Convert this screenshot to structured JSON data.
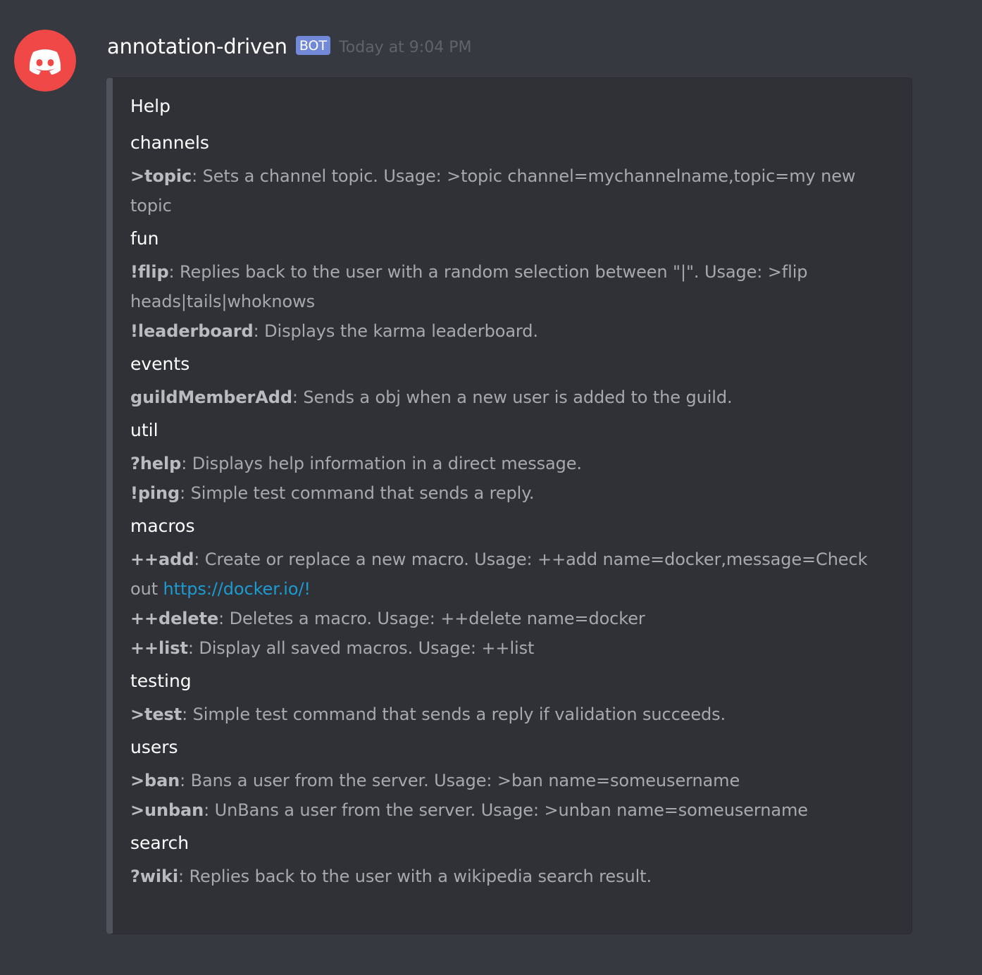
{
  "message": {
    "author": "annotation-driven",
    "bot_tag": "BOT",
    "timestamp": "Today at 9:04 PM",
    "avatar_icon": "discord-logo-icon",
    "avatar_color": "#f04747"
  },
  "embed": {
    "title": "Help",
    "border_color": "#4f545c",
    "fields": [
      {
        "name": "channels",
        "commands": [
          {
            "cmd": ">topic",
            "desc": ": Sets a channel topic. Usage: >topic channel=mychannelname,topic=my new topic"
          }
        ]
      },
      {
        "name": "fun",
        "commands": [
          {
            "cmd": "!flip",
            "desc": ": Replies back to the user with a random selection between \"|\". Usage: >flip heads|tails|whoknows"
          },
          {
            "cmd": "!leaderboard",
            "desc": ": Displays the karma leaderboard."
          }
        ]
      },
      {
        "name": "events",
        "commands": [
          {
            "cmd": "guildMemberAdd",
            "desc": ": Sends a obj when a new user is added to the guild."
          }
        ]
      },
      {
        "name": "util",
        "commands": [
          {
            "cmd": "?help",
            "desc": ": Displays help information in a direct message."
          },
          {
            "cmd": "!ping",
            "desc": ": Simple test command that sends a reply."
          }
        ]
      },
      {
        "name": "macros",
        "commands": [
          {
            "cmd": "++add",
            "desc": ": Create or replace a new macro. Usage: ++add name=docker,message=Check out ",
            "link": "https://docker.io/!"
          },
          {
            "cmd": "++delete",
            "desc": ": Deletes a macro. Usage: ++delete name=docker"
          },
          {
            "cmd": "++list",
            "desc": ": Display all saved macros. Usage: ++list"
          }
        ]
      },
      {
        "name": "testing",
        "commands": [
          {
            "cmd": ">test",
            "desc": ": Simple test command that sends a reply if validation succeeds."
          }
        ]
      },
      {
        "name": "users",
        "commands": [
          {
            "cmd": ">ban",
            "desc": ": Bans a user from the server. Usage: >ban name=someusername"
          },
          {
            "cmd": ">unban",
            "desc": ": UnBans a user from the server. Usage: >unban name=someusername"
          }
        ]
      },
      {
        "name": "search",
        "commands": [
          {
            "cmd": "?wiki",
            "desc": ": Replies back to the user with a wikipedia search result."
          }
        ]
      }
    ]
  },
  "colors": {
    "background": "#36393f",
    "embed_background": "#2f3136",
    "bot_tag": "#7289da",
    "link": "#1d9bd1"
  }
}
